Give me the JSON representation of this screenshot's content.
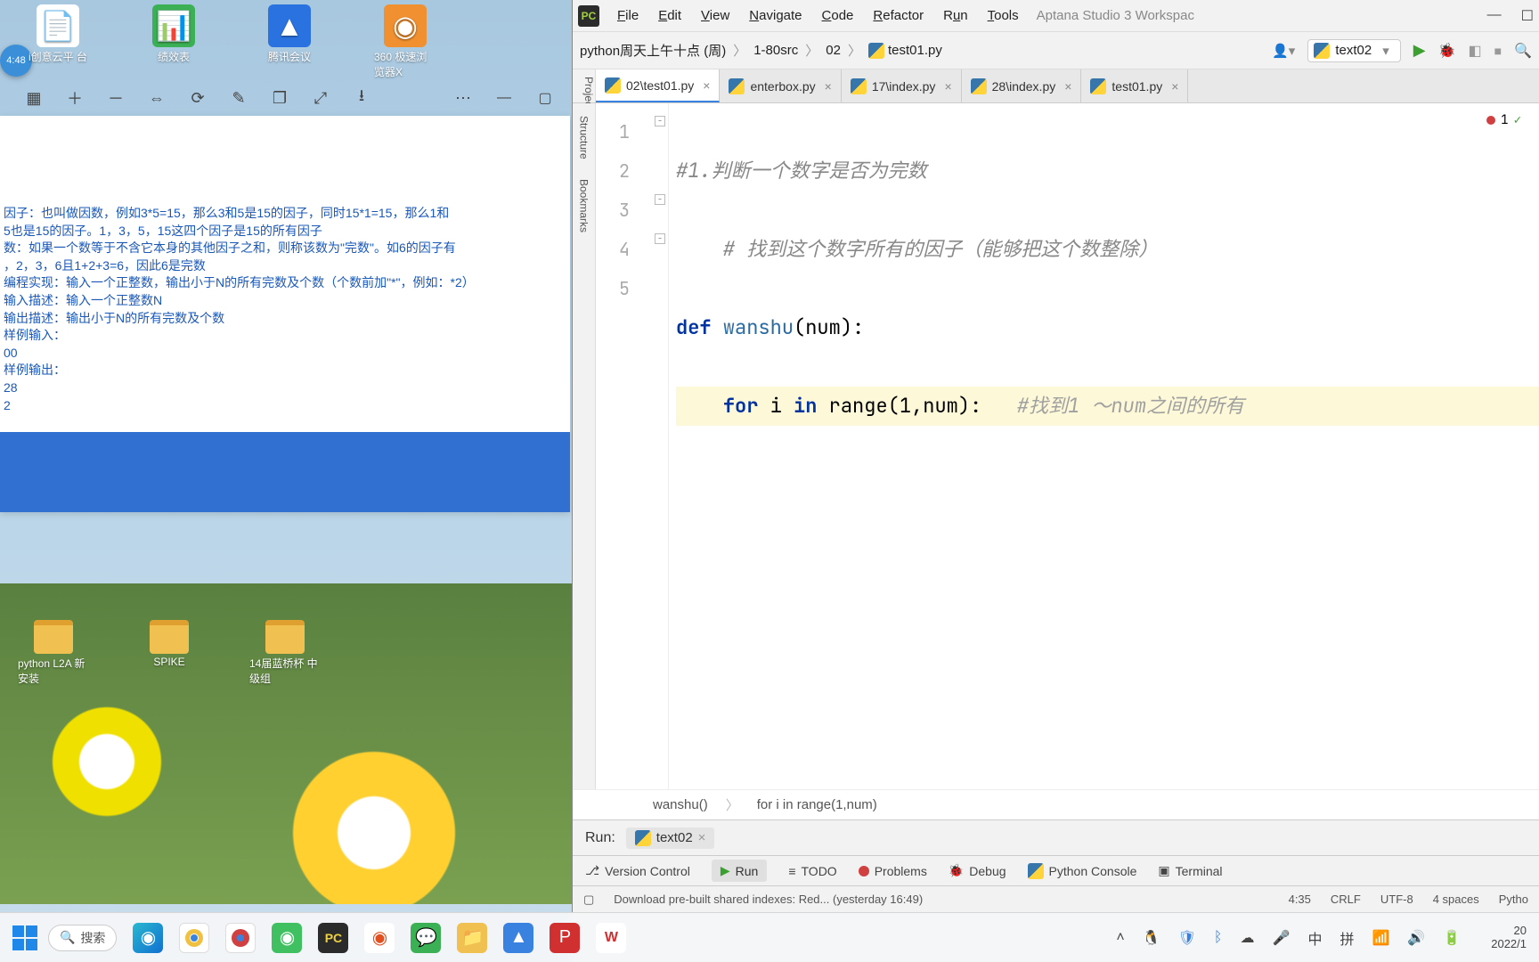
{
  "desktop": {
    "clock": "4:48",
    "icons": [
      {
        "label": "i创意云平\n台"
      },
      {
        "label": "绩效表"
      },
      {
        "label": "腾讯会议"
      },
      {
        "label": "360 极速浏\n览器X"
      }
    ],
    "icons_bottom": [
      {
        "label": "python L2A\n新安装"
      },
      {
        "label": "SPIKE"
      },
      {
        "label": "14届蓝桥杯\n中级组"
      }
    ]
  },
  "left_panel": {
    "toolbar_icons": [
      "grid",
      "zoom-in",
      "zoom-out",
      "fit",
      "rotate",
      "edit",
      "copy",
      "expand",
      "download",
      "more",
      "minimize",
      "maximize"
    ],
    "lines": [
      "因子：也叫做因数，例如3*5=15，那么3和5是15的因子，同时15*1=15，那么1和",
      "5也是15的因子。1，3，5，15这四个因子是15的所有因子",
      "数：如果一个数等于不含它本身的其他因子之和，则称该数为\"完数\"。如6的因子有",
      "，2，3，6且1+2+3=6，因此6是完数",
      "编程实现：输入一个正整数，输出小于N的所有完数及个数（个数前加\"*\"，例如：*2）",
      "输入描述：输入一个正整数N",
      "输出描述：输出小于N的所有完数及个数",
      "样例输入：",
      "00",
      "样例输出：",
      "",
      "28",
      "2"
    ]
  },
  "ide": {
    "menu": [
      "File",
      "Edit",
      "View",
      "Navigate",
      "Code",
      "Refactor",
      "Run",
      "Tools"
    ],
    "window_title": "Aptana Studio 3 Workspac",
    "breadcrumbs": [
      "python周天上午十点 (周)",
      "1-80src",
      "02",
      "test01.py"
    ],
    "run_config": "text02",
    "tabs": [
      {
        "label": "02\\test01.py",
        "active": true
      },
      {
        "label": "enterbox.py"
      },
      {
        "label": "17\\index.py"
      },
      {
        "label": "28\\index.py"
      },
      {
        "label": "test01.py"
      }
    ],
    "vtabs": [
      "Project",
      "Structure",
      "Bookmarks"
    ],
    "error_count": "1",
    "gutter": [
      "1",
      "2",
      "3",
      "4",
      "5"
    ],
    "code": {
      "l1": "#1.判断一个数字是否为完数",
      "l2": "    # 找到这个数字所有的因子（能够把这个数整除）",
      "l3_kw1": "def ",
      "l3_fn": "wanshu",
      "l3_rest": "(num):",
      "l4_pre": "    ",
      "l4_kw1": "for ",
      "l4_var": "i ",
      "l4_kw2": "in ",
      "l4_call": "range(",
      "l4_args": "1,num):",
      "l4_cmt": "   #找到1 ～num之间的所有"
    },
    "code_breadcrumb": [
      "wanshu()",
      "for i in range(1,num)"
    ],
    "run_panel_label": "Run:",
    "run_panel_tab": "text02",
    "bottom_tools": {
      "vcs": "Version Control",
      "run": "Run",
      "todo": "TODO",
      "problems": "Problems",
      "debug": "Debug",
      "pyconsole": "Python Console",
      "terminal": "Terminal"
    },
    "statusbar": {
      "msg": "Download pre-built shared indexes: Red... (yesterday 16:49)",
      "pos": "4:35",
      "eol": "CRLF",
      "enc": "UTF-8",
      "indent": "4 spaces",
      "interp": "Pytho"
    }
  },
  "taskbar": {
    "search_placeholder": "搜索",
    "ime1": "中",
    "ime2": "拼",
    "time1": "20",
    "time2": "2022/1"
  }
}
